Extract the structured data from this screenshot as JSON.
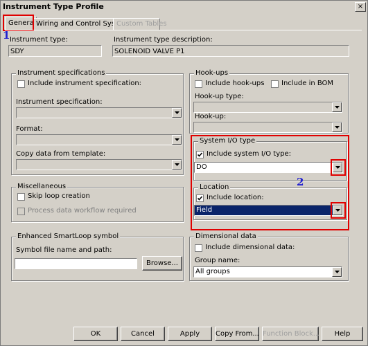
{
  "window": {
    "title": "Instrument Type Profile",
    "close_glyph": "×"
  },
  "tabs": [
    {
      "label": "General",
      "active": true
    },
    {
      "label": "Wiring and Control System"
    },
    {
      "label": "Custom Tables",
      "disabled": true
    }
  ],
  "markers": {
    "one": "1",
    "two": "2"
  },
  "general": {
    "instrument_type_label": "Instrument type:",
    "instrument_type_value": "SDY",
    "description_label": "Instrument type description:",
    "description_value": "SOLENOID VALVE P1"
  },
  "instrument_spec": {
    "legend": "Instrument specifications",
    "include_label": "Include instrument specification:",
    "spec_label": "Instrument specification:",
    "format_label": "Format:",
    "copy_label": "Copy data from template:"
  },
  "hookups": {
    "legend": "Hook-ups",
    "include_label": "Include hook-ups",
    "bom_label": "Include in BOM",
    "type_label": "Hook-up type:",
    "hookup_label": "Hook-up:"
  },
  "system_io": {
    "legend": "System I/O type",
    "include_label": "Include system I/O type:",
    "value": "DO"
  },
  "location": {
    "legend": "Location",
    "include_label": "Include location:",
    "value": "Field"
  },
  "misc": {
    "legend": "Miscellaneous",
    "skip_label": "Skip loop creation",
    "workflow_label": "Process data workflow required"
  },
  "smartloop": {
    "legend": "Enhanced SmartLoop symbol",
    "path_label": "Symbol file name and path:",
    "path_value": "",
    "browse_label": "Browse..."
  },
  "dimensional": {
    "legend": "Dimensional data",
    "include_label": "Include dimensional data:",
    "group_label": "Group name:",
    "group_value": "All groups"
  },
  "buttons": {
    "ok": "OK",
    "cancel": "Cancel",
    "apply": "Apply",
    "copy_from": "Copy From...",
    "function_block": "Function Block...",
    "help": "Help"
  }
}
